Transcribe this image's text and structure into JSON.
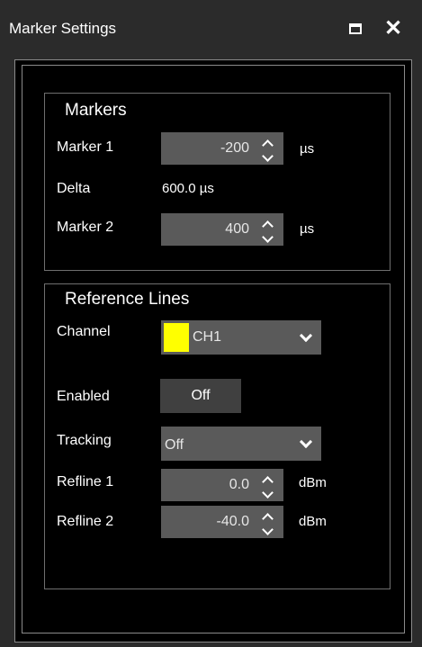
{
  "window": {
    "title": "Marker Settings"
  },
  "markers": {
    "title": "Markers",
    "marker1": {
      "label": "Marker 1",
      "value": "-200",
      "unit": "µs"
    },
    "delta": {
      "label": "Delta",
      "value": "600.0 µs"
    },
    "marker2": {
      "label": "Marker 2",
      "value": "400",
      "unit": "µs"
    }
  },
  "reference_lines": {
    "title": "Reference Lines",
    "channel": {
      "label": "Channel",
      "value": "CH1",
      "color": "#ffff00"
    },
    "enabled": {
      "label": "Enabled",
      "value": "Off"
    },
    "tracking": {
      "label": "Tracking",
      "value": "Off"
    },
    "refline1": {
      "label": "Refline 1",
      "value": "0.0",
      "unit": "dBm"
    },
    "refline2": {
      "label": "Refline 2",
      "value": "-40.0",
      "unit": "dBm"
    }
  },
  "icons": [
    "maximize-icon",
    "close-icon",
    "spin-up-icon",
    "spin-down-icon",
    "dropdown-chevron-icon"
  ],
  "colors": {
    "window_bg": "#2b2b2b",
    "panel_bg": "#000000",
    "field_bg": "#5a5a5a",
    "button_bg": "#404040"
  }
}
